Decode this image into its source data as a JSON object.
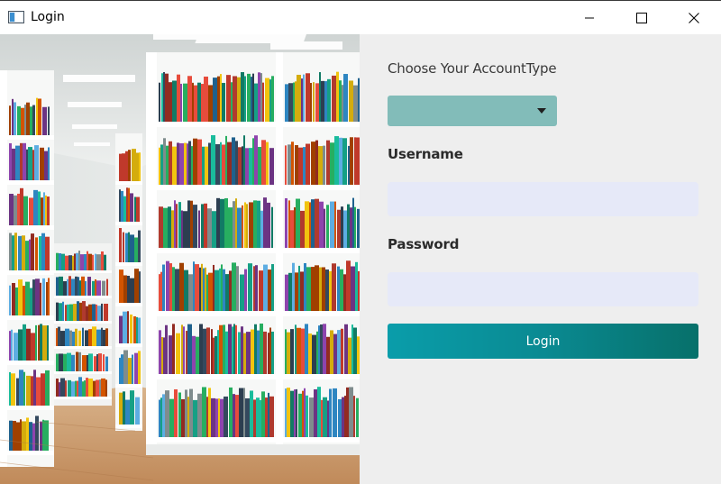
{
  "window": {
    "title": "Login",
    "controls": [
      "minimize-icon",
      "maximize-icon",
      "close-icon"
    ]
  },
  "hero_image": {
    "subject": "library-bookshelves"
  },
  "form": {
    "account_type_label": "Choose Your AccountType",
    "account_type_select": {
      "selected": "",
      "icon": "chevron-down-icon"
    },
    "username_label": "Username",
    "username_value": "",
    "password_label": "Password",
    "password_value": "",
    "login_button_label": "Login"
  },
  "colors": {
    "select_bg": "#82bcb9",
    "input_bg": "#e6e9f8",
    "button_gradient_start": "#0a9daa",
    "button_gradient_end": "#07706a",
    "form_bg": "#eeeeee"
  }
}
